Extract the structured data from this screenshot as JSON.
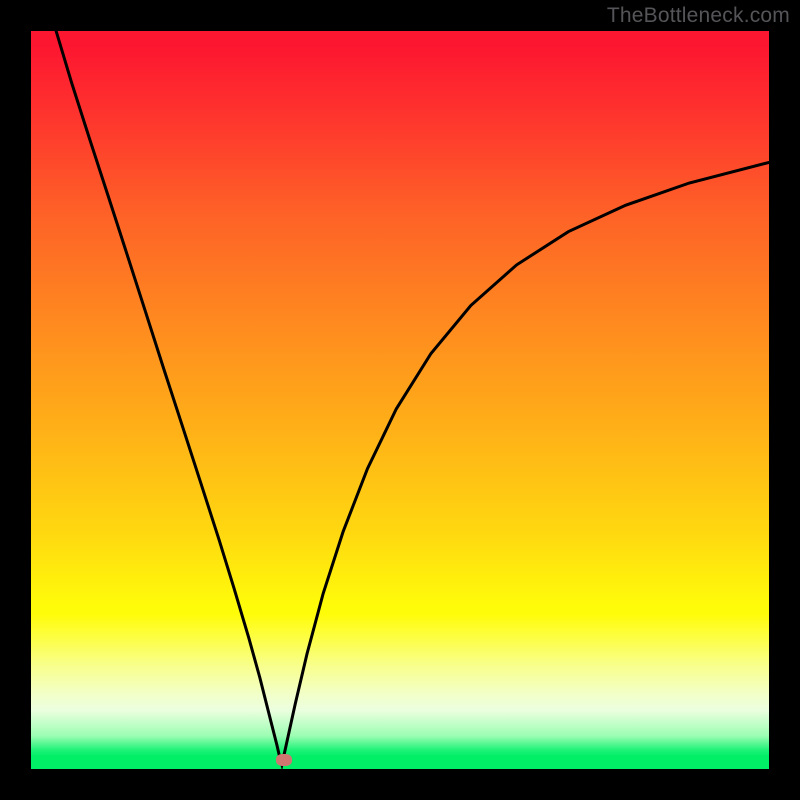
{
  "watermark": "TheBottleneck.com",
  "chart_data": {
    "type": "line",
    "title": "",
    "xlabel": "",
    "ylabel": "",
    "x_range": [
      0,
      100
    ],
    "y_range": [
      0,
      100
    ],
    "note": "Axes and scales are not labeled in the source image; x/y are normalized 0–100 estimates read from pixel position. Curve is a V-shaped cost/bottleneck profile with minimum near x≈34.",
    "series": [
      {
        "name": "left-branch",
        "x": [
          3.4,
          5.5,
          8.0,
          10.5,
          13.0,
          15.5,
          18.0,
          20.5,
          23.0,
          25.5,
          27.5,
          29.5,
          31.0,
          32.5,
          33.3,
          33.7,
          34.0
        ],
        "y": [
          100.0,
          93.0,
          85.2,
          77.5,
          69.8,
          62.0,
          54.2,
          46.5,
          38.8,
          31.0,
          24.5,
          17.8,
          12.4,
          6.5,
          3.3,
          1.6,
          0.6
        ]
      },
      {
        "name": "right-branch",
        "x": [
          34.0,
          34.6,
          35.8,
          37.4,
          39.6,
          42.3,
          45.6,
          49.5,
          54.2,
          59.6,
          65.8,
          72.8,
          80.6,
          89.2,
          100.0
        ],
        "y": [
          0.6,
          3.3,
          8.8,
          15.6,
          23.8,
          32.2,
          40.7,
          48.8,
          56.3,
          62.8,
          68.3,
          72.8,
          76.4,
          79.4,
          82.2
        ]
      }
    ],
    "marker": {
      "x": 34.3,
      "y": 1.2,
      "color": "#ce7771"
    },
    "gradient_stops": [
      {
        "pos": 0.0,
        "color": "#fd1630"
      },
      {
        "pos": 0.4,
        "color": "#ff8b1f"
      },
      {
        "pos": 0.78,
        "color": "#fffc0a"
      },
      {
        "pos": 0.98,
        "color": "#01ee67"
      }
    ]
  }
}
